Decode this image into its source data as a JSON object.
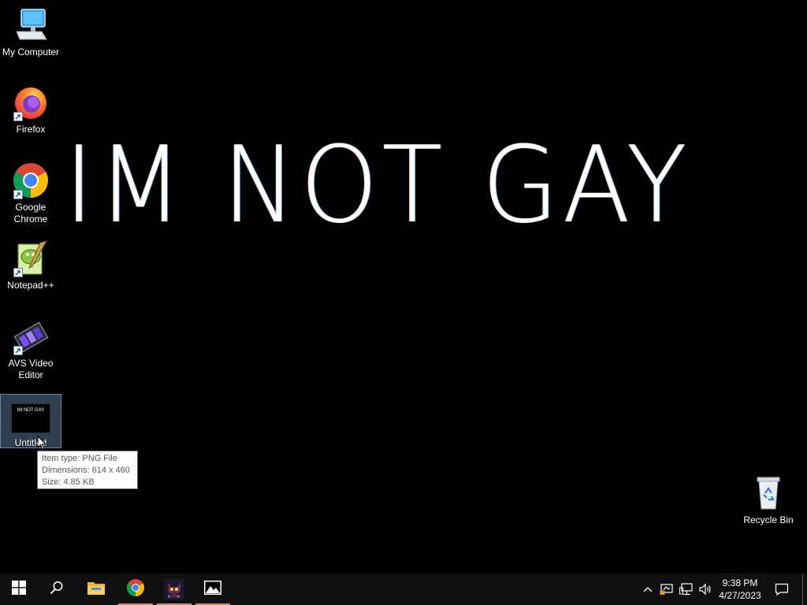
{
  "wallpaper": {
    "text": "IM NOT GAY"
  },
  "desktop_icons": [
    {
      "label": "My Computer",
      "icon": "computer-icon"
    },
    {
      "label": "Firefox",
      "icon": "firefox-icon"
    },
    {
      "label": "Google Chrome",
      "icon": "chrome-icon"
    },
    {
      "label": "Notepad++",
      "icon": "notepadpp-icon"
    },
    {
      "label": "AVS Video Editor",
      "icon": "avs-video-editor-icon"
    },
    {
      "label": "Untitled",
      "icon": "png-thumbnail-icon",
      "thumbnail_text": "IM NOT GAY"
    },
    {
      "label": "Recycle Bin",
      "icon": "recycle-bin-icon"
    }
  ],
  "tooltip": {
    "line1": "Item type: PNG File",
    "line2": "Dimensions: 614 x 460",
    "line3": "Size: 4.85 KB"
  },
  "taskbar": {
    "pinned": [
      {
        "name": "start-button",
        "icon": "windows-logo-icon"
      },
      {
        "name": "search-button",
        "icon": "search-icon"
      },
      {
        "name": "file-explorer",
        "icon": "folder-icon"
      },
      {
        "name": "chrome",
        "icon": "chrome-icon"
      },
      {
        "name": "nitw",
        "icon": "nitw-icon",
        "label": "NITW"
      },
      {
        "name": "photos",
        "icon": "photos-icon"
      }
    ],
    "tray": {
      "time": "9:38 PM",
      "date": "4/27/2023"
    }
  },
  "colors": {
    "taskbar_bg": "#101010",
    "active_indicator": "#c98a5a",
    "selection": "#648cb4"
  }
}
